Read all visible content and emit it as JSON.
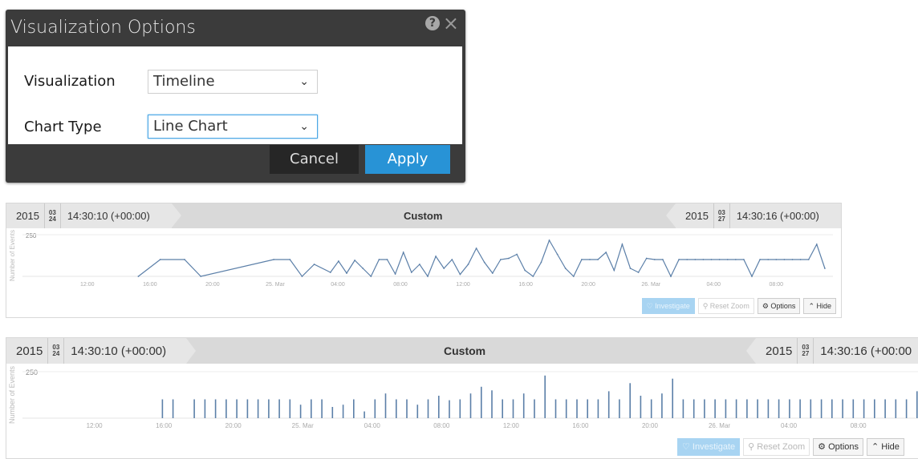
{
  "dialog": {
    "title": "Visualization Options",
    "help_icon": "?",
    "close_icon": "×",
    "fields": [
      {
        "label": "Visualization",
        "value": "Timeline"
      },
      {
        "label": "Chart Type",
        "value": "Line Chart"
      }
    ],
    "cancel_label": "Cancel",
    "apply_label": "Apply",
    "chevron": "⌄"
  },
  "timeline1": {
    "start": {
      "year": "2015",
      "month": "03",
      "day": "24",
      "time": "14:30:10 (+00:00)"
    },
    "mode": "Custom",
    "end": {
      "year": "2015",
      "month": "03",
      "day": "27",
      "time": "14:30:16 (+00:00)"
    },
    "buttons": {
      "investigate": "Investigate",
      "reset_zoom": "Reset Zoom",
      "options": "Options",
      "hide": "Hide"
    }
  },
  "timeline2": {
    "start": {
      "year": "2015",
      "month": "03",
      "day": "24",
      "time": "14:30:10 (+00:00)"
    },
    "mode": "Custom",
    "end": {
      "year": "2015",
      "month": "03",
      "day": "27",
      "time": "14:30:16 (+00:00"
    },
    "buttons": {
      "investigate": "Investigate",
      "reset_zoom": "Reset Zoom",
      "options": "Options",
      "hide": "Hide"
    }
  },
  "chart_data": [
    {
      "type": "line",
      "ylabel": "Number of Events",
      "ymax_label": "250",
      "x_tick_labels": [
        "12:00",
        "16:00",
        "20:00",
        "25. Mar",
        "04:00",
        "08:00",
        "12:00",
        "16:00",
        "20:00",
        "26. Mar",
        "04:00",
        "08:00"
      ],
      "note": "values shown as relative event counts on 0-1 scale of axis max",
      "x": [
        0.143,
        0.17,
        0.2,
        0.22,
        0.31,
        0.33,
        0.345,
        0.36,
        0.38,
        0.39,
        0.4,
        0.41,
        0.42,
        0.43,
        0.44,
        0.45,
        0.46,
        0.47,
        0.48,
        0.49,
        0.5,
        0.51,
        0.52,
        0.53,
        0.54,
        0.55,
        0.56,
        0.57,
        0.58,
        0.59,
        0.6,
        0.61,
        0.62,
        0.63,
        0.64,
        0.65,
        0.66,
        0.67,
        0.68,
        0.69,
        0.7,
        0.71,
        0.72,
        0.73,
        0.74,
        0.75,
        0.76,
        0.77,
        0.78,
        0.79,
        0.8,
        0.81,
        0.82,
        0.83,
        0.84,
        0.85,
        0.86,
        0.87,
        0.88,
        0.89,
        0.9,
        0.91,
        0.92,
        0.93,
        0.94,
        0.95,
        0.96,
        0.97,
        0.98,
        0.99
      ],
      "y": [
        0.0,
        0.42,
        0.42,
        0.0,
        0.42,
        0.42,
        0.0,
        0.3,
        0.1,
        0.38,
        0.08,
        0.4,
        0.2,
        0.0,
        0.42,
        0.42,
        0.06,
        0.6,
        0.1,
        0.3,
        0.0,
        0.5,
        0.2,
        0.42,
        0.05,
        0.3,
        0.7,
        0.35,
        0.08,
        0.42,
        0.45,
        0.55,
        0.15,
        0.0,
        0.35,
        0.9,
        0.55,
        0.2,
        0.0,
        0.42,
        0.42,
        0.42,
        0.6,
        0.15,
        0.8,
        0.2,
        0.1,
        0.45,
        0.42,
        0.42,
        0.0,
        0.42,
        0.42,
        0.42,
        0.42,
        0.42,
        0.42,
        0.42,
        0.42,
        0.42,
        0.0,
        0.42,
        0.42,
        0.42,
        0.42,
        0.42,
        0.42,
        0.42,
        0.8,
        0.2
      ]
    },
    {
      "type": "bar",
      "ylabel": "Number of Events",
      "ymax_label": "250",
      "x_tick_labels": [
        "12:00",
        "16:00",
        "20:00",
        "25. Mar",
        "04:00",
        "08:00",
        "12:00",
        "16:00",
        "20:00",
        "26. Mar",
        "04:00",
        "08:00"
      ],
      "note": "values shown as relative event counts on 0-1 scale of axis max",
      "values": [
        0.42,
        0.42,
        0.0,
        0.42,
        0.42,
        0.42,
        0.42,
        0.42,
        0.42,
        0.42,
        0.42,
        0.42,
        0.42,
        0.3,
        0.42,
        0.42,
        0.25,
        0.3,
        0.42,
        0.15,
        0.42,
        0.55,
        0.42,
        0.42,
        0.3,
        0.42,
        0.5,
        0.4,
        0.42,
        0.55,
        0.7,
        0.62,
        0.42,
        0.42,
        0.55,
        0.42,
        0.95,
        0.42,
        0.42,
        0.42,
        0.42,
        0.42,
        0.6,
        0.42,
        0.78,
        0.5,
        0.42,
        0.55,
        0.88,
        0.42,
        0.42,
        0.42,
        0.42,
        0.42,
        0.42,
        0.42,
        0.42,
        0.42,
        0.42,
        0.42,
        0.42,
        0.42,
        0.42,
        0.42,
        0.42,
        0.42,
        0.42,
        0.42,
        0.42,
        0.42,
        0.42,
        0.6
      ]
    }
  ]
}
